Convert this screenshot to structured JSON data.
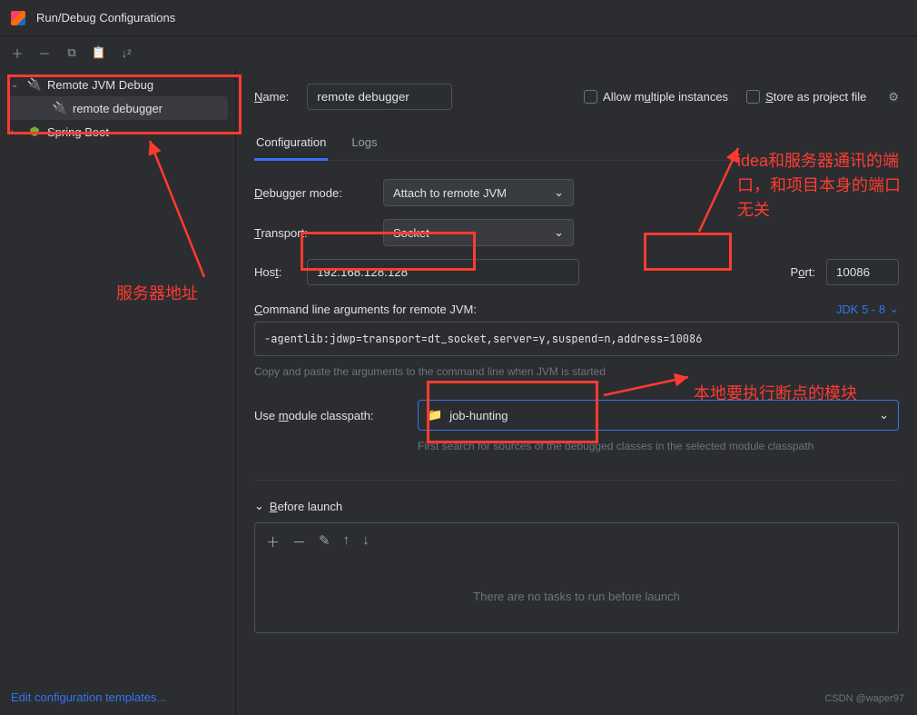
{
  "window": {
    "title": "Run/Debug Configurations"
  },
  "sidebar": {
    "items": [
      {
        "label": "Remote JVM Debug",
        "expanded": true
      },
      {
        "label": "remote debugger",
        "selected": true
      },
      {
        "label": "Spring Boot",
        "expanded": false
      }
    ]
  },
  "form": {
    "name_label": "Name:",
    "name_value": "remote debugger",
    "allow_multiple_label": "Allow multiple instances",
    "store_project_label": "Store as project file",
    "tabs": {
      "configuration": "Configuration",
      "logs": "Logs"
    },
    "debugger_mode_label": "Debugger mode:",
    "debugger_mode_value": "Attach to remote JVM",
    "transport_label": "Transport:",
    "transport_value": "Socket",
    "host_label": "Host:",
    "host_value": "192.168.128.128",
    "port_label": "Port:",
    "port_value": "10086",
    "cmdline_label": "Command line arguments for remote JVM:",
    "jdk_label": "JDK 5 - 8",
    "cmdline_value": "-agentlib:jdwp=transport=dt_socket,server=y,suspend=n,address=10086",
    "copy_hint": "Copy and paste the arguments to the command line when JVM is started",
    "module_label": "Use module classpath:",
    "module_value": "job-hunting",
    "module_hint": "First search for sources of the debugged classes in the selected module classpath",
    "before_launch_label": "Before launch",
    "before_launch_empty": "There are no tasks to run before launch"
  },
  "footer": {
    "edit_templates": "Edit configuration templates...",
    "watermark": "CSDN @waper97"
  },
  "annotations": {
    "server_addr": "服务器地址",
    "port_note": "idea和服务器通讯的端口，和项目本身的端口无关",
    "module_note": "本地要执行断点的模块"
  }
}
